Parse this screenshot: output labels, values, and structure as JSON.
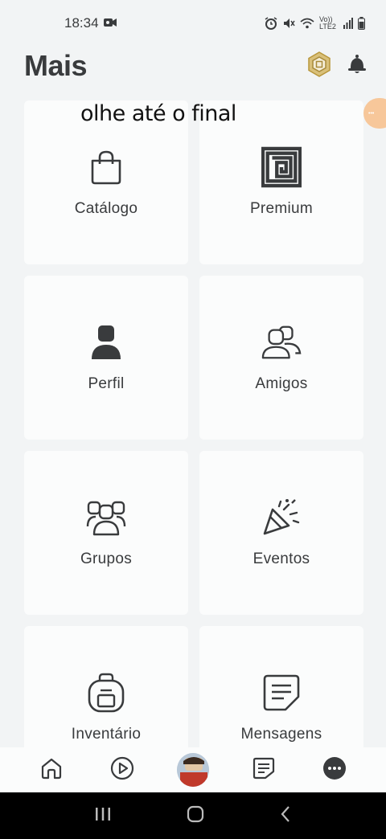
{
  "status_bar": {
    "time": "18:34",
    "network_label": "Vo)) LTE2"
  },
  "header": {
    "title": "Mais"
  },
  "overlay_caption": "olhe até o final",
  "tiles": [
    {
      "label": "Catálogo",
      "icon": "shopping-bag-icon"
    },
    {
      "label": "Premium",
      "icon": "premium-icon"
    },
    {
      "label": "Perfil",
      "icon": "profile-icon"
    },
    {
      "label": "Amigos",
      "icon": "friends-icon"
    },
    {
      "label": "Grupos",
      "icon": "groups-icon"
    },
    {
      "label": "Eventos",
      "icon": "party-popper-icon"
    },
    {
      "label": "Inventário",
      "icon": "backpack-icon"
    },
    {
      "label": "Mensagens",
      "icon": "message-icon"
    }
  ],
  "bottom_nav": [
    {
      "name": "home",
      "icon": "home-icon"
    },
    {
      "name": "discover",
      "icon": "play-icon"
    },
    {
      "name": "avatar",
      "icon": "avatar"
    },
    {
      "name": "chat",
      "icon": "chat-icon"
    },
    {
      "name": "more",
      "icon": "more-icon"
    }
  ],
  "colors": {
    "background": "#f2f4f5",
    "tile": "#fbfcfc",
    "text": "#393b3d",
    "robux_gold": "#c9a94b"
  }
}
